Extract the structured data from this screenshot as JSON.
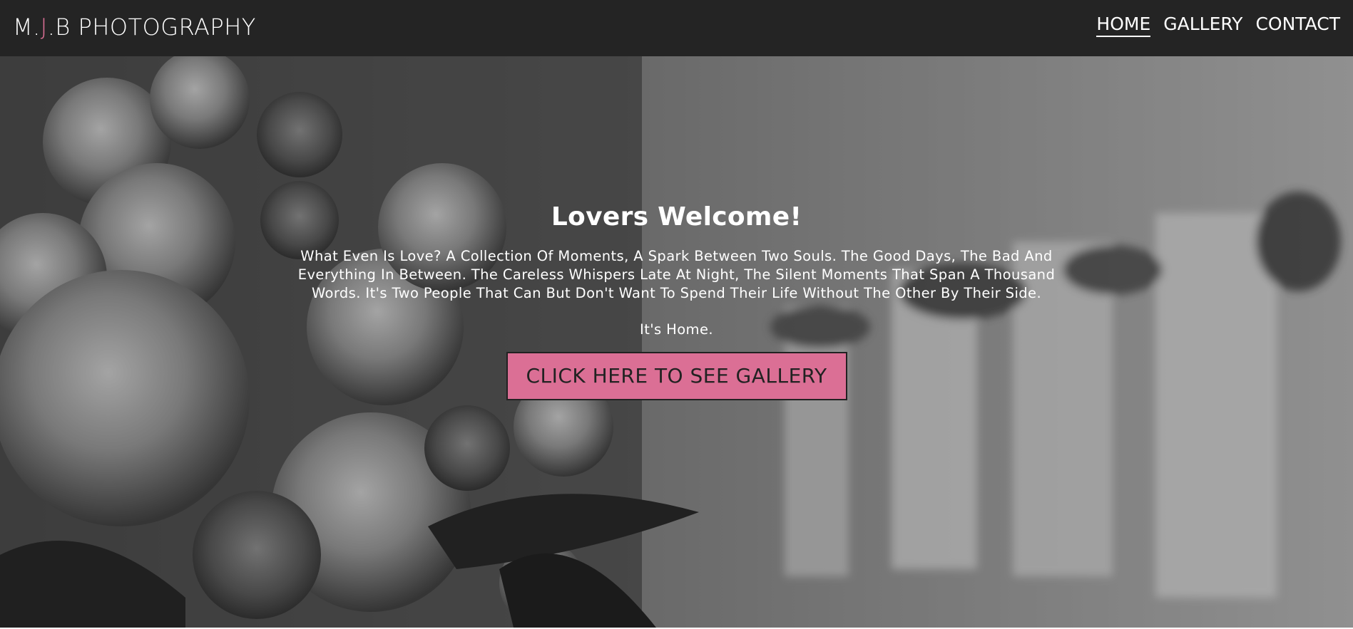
{
  "brand": {
    "prefix": "M.",
    "accent": "J",
    "suffix": ".B PHOTOGRAPHY",
    "accent_color": "#db6f95"
  },
  "nav": {
    "items": [
      {
        "label": "HOME",
        "active": true
      },
      {
        "label": "GALLERY",
        "active": false
      },
      {
        "label": "CONTACT",
        "active": false
      }
    ]
  },
  "hero": {
    "title": "Lovers Welcome!",
    "text": "What Even Is Love? A Collection Of Moments, A Spark Between Two Souls. The Good Days, The Bad And Everything In Between. The Careless Whispers Late At Night, The Silent Moments That Span A Thousand Words. It's Two People That Can But Don't Want To Spend Their Life Without The Other By Their Side.",
    "subtext": "It's Home.",
    "cta_label": "CLICK HERE TO SEE GALLERY",
    "cta_color": "#db6f95",
    "background": "grayscale-roses-wedding-photo"
  },
  "colors": {
    "navbar": "#242424",
    "text": "#ffffff"
  }
}
